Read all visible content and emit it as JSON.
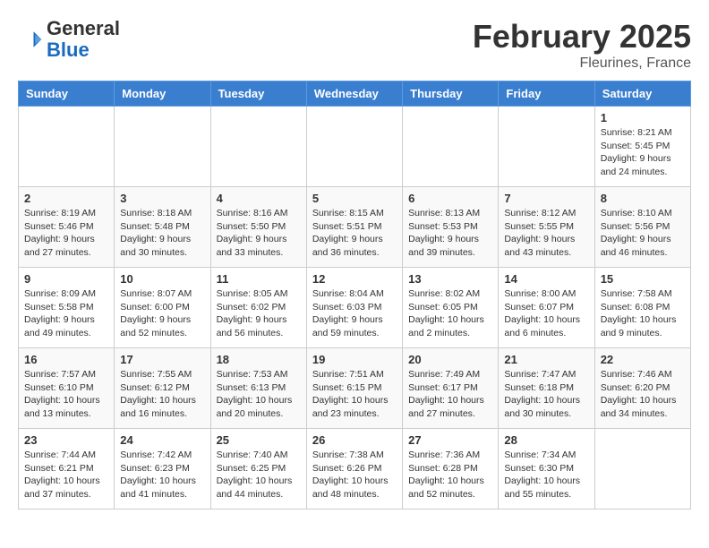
{
  "header": {
    "logo_general": "General",
    "logo_blue": "Blue",
    "month_title": "February 2025",
    "location": "Fleurines, France"
  },
  "days_of_week": [
    "Sunday",
    "Monday",
    "Tuesday",
    "Wednesday",
    "Thursday",
    "Friday",
    "Saturday"
  ],
  "weeks": [
    [
      {
        "day": "",
        "info": ""
      },
      {
        "day": "",
        "info": ""
      },
      {
        "day": "",
        "info": ""
      },
      {
        "day": "",
        "info": ""
      },
      {
        "day": "",
        "info": ""
      },
      {
        "day": "",
        "info": ""
      },
      {
        "day": "1",
        "info": "Sunrise: 8:21 AM\nSunset: 5:45 PM\nDaylight: 9 hours and 24 minutes."
      }
    ],
    [
      {
        "day": "2",
        "info": "Sunrise: 8:19 AM\nSunset: 5:46 PM\nDaylight: 9 hours and 27 minutes."
      },
      {
        "day": "3",
        "info": "Sunrise: 8:18 AM\nSunset: 5:48 PM\nDaylight: 9 hours and 30 minutes."
      },
      {
        "day": "4",
        "info": "Sunrise: 8:16 AM\nSunset: 5:50 PM\nDaylight: 9 hours and 33 minutes."
      },
      {
        "day": "5",
        "info": "Sunrise: 8:15 AM\nSunset: 5:51 PM\nDaylight: 9 hours and 36 minutes."
      },
      {
        "day": "6",
        "info": "Sunrise: 8:13 AM\nSunset: 5:53 PM\nDaylight: 9 hours and 39 minutes."
      },
      {
        "day": "7",
        "info": "Sunrise: 8:12 AM\nSunset: 5:55 PM\nDaylight: 9 hours and 43 minutes."
      },
      {
        "day": "8",
        "info": "Sunrise: 8:10 AM\nSunset: 5:56 PM\nDaylight: 9 hours and 46 minutes."
      }
    ],
    [
      {
        "day": "9",
        "info": "Sunrise: 8:09 AM\nSunset: 5:58 PM\nDaylight: 9 hours and 49 minutes."
      },
      {
        "day": "10",
        "info": "Sunrise: 8:07 AM\nSunset: 6:00 PM\nDaylight: 9 hours and 52 minutes."
      },
      {
        "day": "11",
        "info": "Sunrise: 8:05 AM\nSunset: 6:02 PM\nDaylight: 9 hours and 56 minutes."
      },
      {
        "day": "12",
        "info": "Sunrise: 8:04 AM\nSunset: 6:03 PM\nDaylight: 9 hours and 59 minutes."
      },
      {
        "day": "13",
        "info": "Sunrise: 8:02 AM\nSunset: 6:05 PM\nDaylight: 10 hours and 2 minutes."
      },
      {
        "day": "14",
        "info": "Sunrise: 8:00 AM\nSunset: 6:07 PM\nDaylight: 10 hours and 6 minutes."
      },
      {
        "day": "15",
        "info": "Sunrise: 7:58 AM\nSunset: 6:08 PM\nDaylight: 10 hours and 9 minutes."
      }
    ],
    [
      {
        "day": "16",
        "info": "Sunrise: 7:57 AM\nSunset: 6:10 PM\nDaylight: 10 hours and 13 minutes."
      },
      {
        "day": "17",
        "info": "Sunrise: 7:55 AM\nSunset: 6:12 PM\nDaylight: 10 hours and 16 minutes."
      },
      {
        "day": "18",
        "info": "Sunrise: 7:53 AM\nSunset: 6:13 PM\nDaylight: 10 hours and 20 minutes."
      },
      {
        "day": "19",
        "info": "Sunrise: 7:51 AM\nSunset: 6:15 PM\nDaylight: 10 hours and 23 minutes."
      },
      {
        "day": "20",
        "info": "Sunrise: 7:49 AM\nSunset: 6:17 PM\nDaylight: 10 hours and 27 minutes."
      },
      {
        "day": "21",
        "info": "Sunrise: 7:47 AM\nSunset: 6:18 PM\nDaylight: 10 hours and 30 minutes."
      },
      {
        "day": "22",
        "info": "Sunrise: 7:46 AM\nSunset: 6:20 PM\nDaylight: 10 hours and 34 minutes."
      }
    ],
    [
      {
        "day": "23",
        "info": "Sunrise: 7:44 AM\nSunset: 6:21 PM\nDaylight: 10 hours and 37 minutes."
      },
      {
        "day": "24",
        "info": "Sunrise: 7:42 AM\nSunset: 6:23 PM\nDaylight: 10 hours and 41 minutes."
      },
      {
        "day": "25",
        "info": "Sunrise: 7:40 AM\nSunset: 6:25 PM\nDaylight: 10 hours and 44 minutes."
      },
      {
        "day": "26",
        "info": "Sunrise: 7:38 AM\nSunset: 6:26 PM\nDaylight: 10 hours and 48 minutes."
      },
      {
        "day": "27",
        "info": "Sunrise: 7:36 AM\nSunset: 6:28 PM\nDaylight: 10 hours and 52 minutes."
      },
      {
        "day": "28",
        "info": "Sunrise: 7:34 AM\nSunset: 6:30 PM\nDaylight: 10 hours and 55 minutes."
      },
      {
        "day": "",
        "info": ""
      }
    ]
  ]
}
